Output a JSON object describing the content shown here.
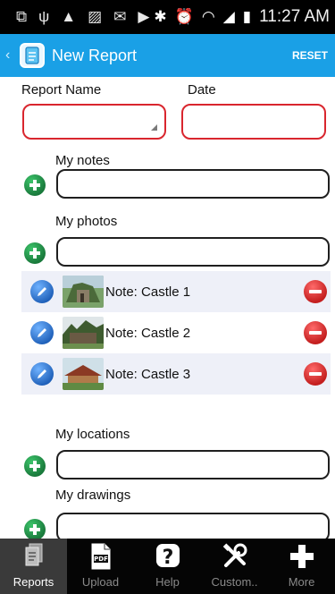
{
  "status_bar": {
    "time": "11:27 AM"
  },
  "action_bar": {
    "title": "New Report",
    "reset_label": "RESET",
    "back_glyph": "‹"
  },
  "form": {
    "report_name_label": "Report Name",
    "date_label": "Date",
    "report_name_value": "",
    "date_value": "",
    "notes_label": "My notes",
    "photos_label": "My photos",
    "locations_label": "My locations",
    "drawings_label": "My drawings"
  },
  "photos": [
    {
      "note": "Note:  Castle 1"
    },
    {
      "note": "Note:  Castle 2"
    },
    {
      "note": "Note:  Castle 3"
    }
  ],
  "tabs": [
    {
      "label": "Reports",
      "icon": "reports-icon"
    },
    {
      "label": "Upload",
      "icon": "pdf-icon"
    },
    {
      "label": "Help",
      "icon": "help-icon"
    },
    {
      "label": "Custom..",
      "icon": "tools-icon"
    },
    {
      "label": "More",
      "icon": "plus-icon"
    }
  ],
  "colors": {
    "accent": "#1aa0e6",
    "error_border": "#d9262e",
    "add_green": "#1f8a44",
    "remove_red": "#d32a2a"
  }
}
